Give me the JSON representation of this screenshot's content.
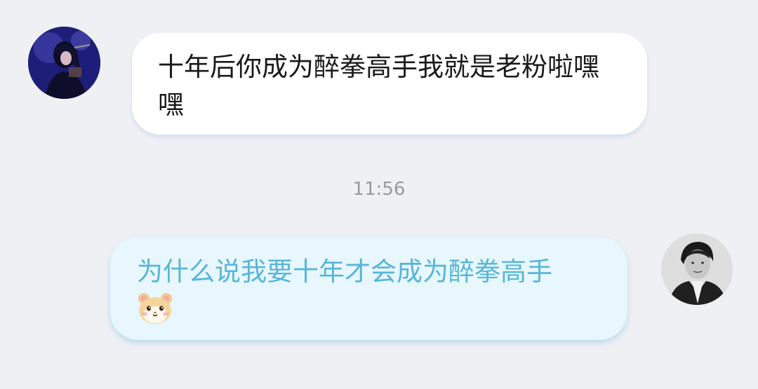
{
  "messages": [
    {
      "side": "incoming",
      "text": "十年后你成为醉拳高手我就是老粉啦嘿嘿",
      "avatar_icon": "friend-avatar-concert"
    },
    {
      "side": "outgoing",
      "text": "为什么说我要十年才会成为醉拳高手",
      "sticker_icon": "hamster-face-emoji",
      "avatar_icon": "self-avatar-portrait"
    }
  ],
  "timestamp": "11:56",
  "colors": {
    "background": "#eff0f4",
    "incoming_bubble": "#ffffff",
    "outgoing_bubble": "#e8f7fd",
    "outgoing_text": "#57b6d9",
    "timestamp_text": "#9a9a9a"
  }
}
